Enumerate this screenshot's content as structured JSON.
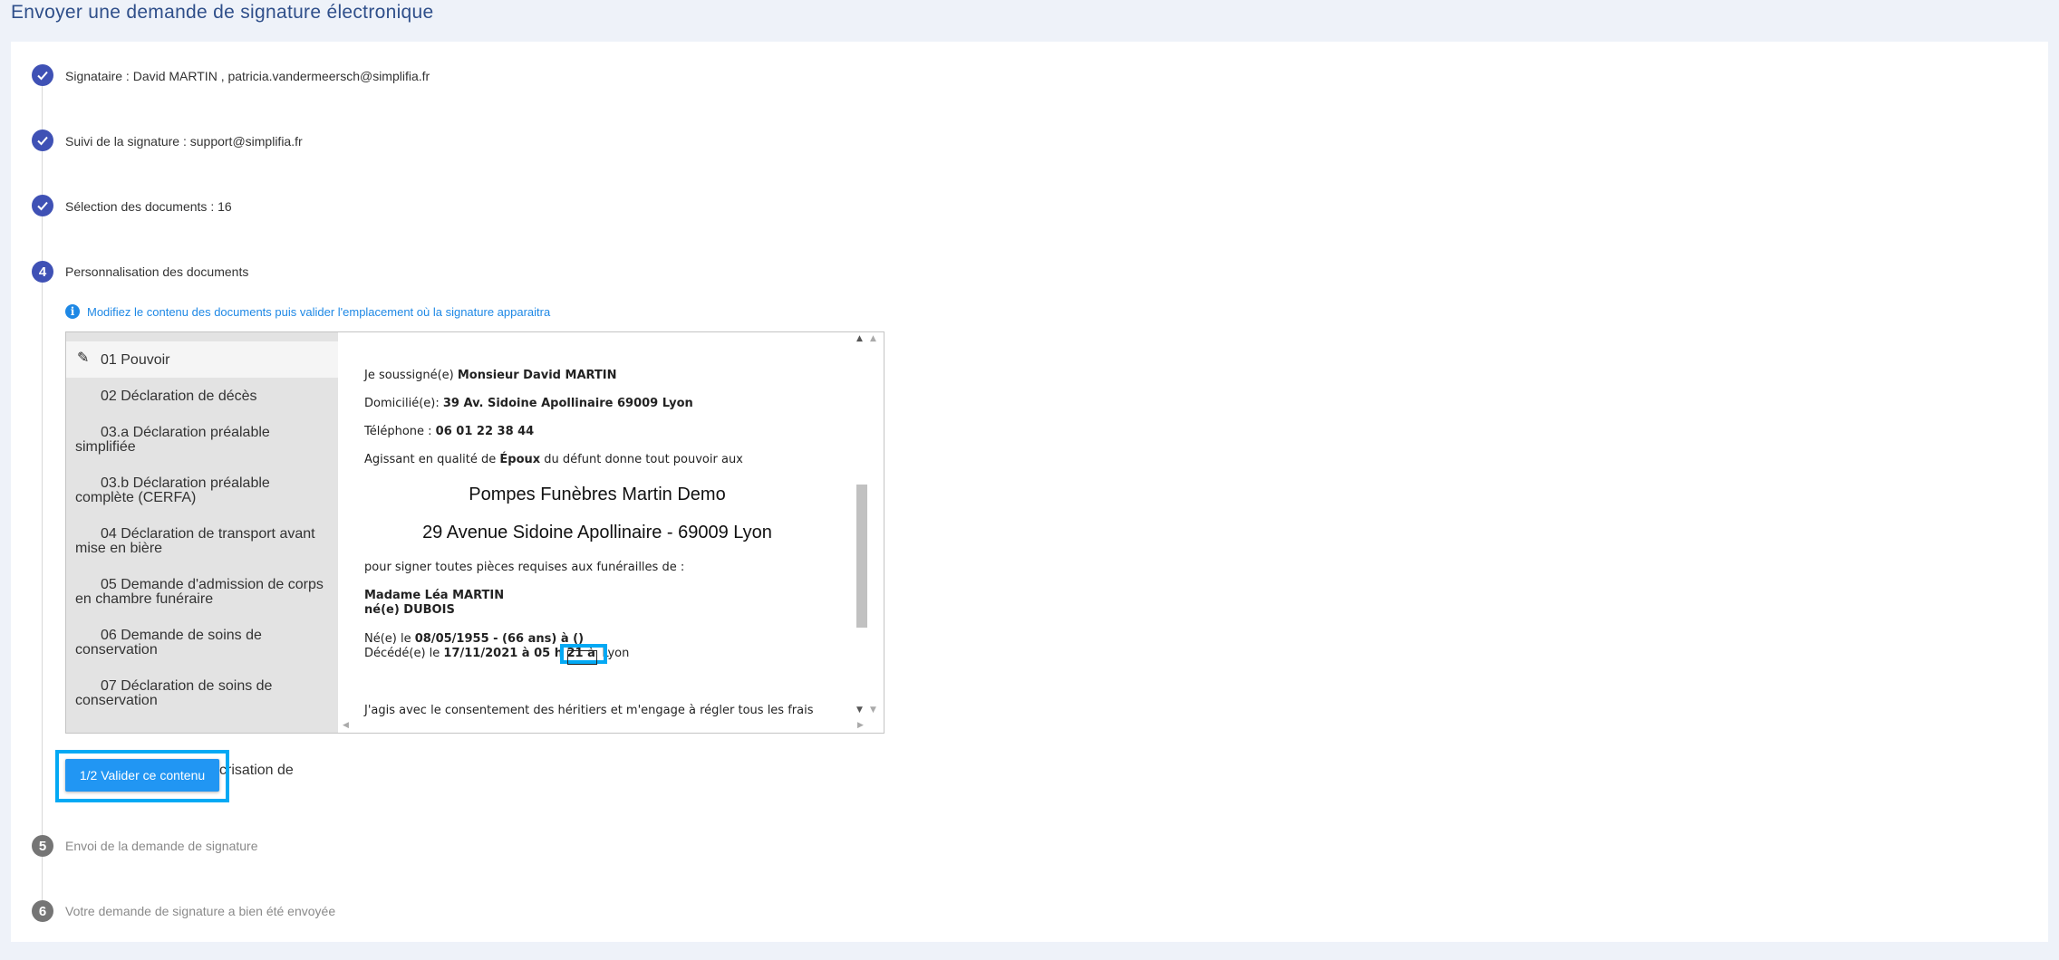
{
  "page": {
    "title": "Envoyer une demande de signature électronique"
  },
  "steps": [
    {
      "number": "",
      "status": "done",
      "label": "Signataire : David MARTIN , patricia.vandermeersch@simplifia.fr"
    },
    {
      "number": "",
      "status": "done",
      "label": "Suivi de la signature : support@simplifia.fr"
    },
    {
      "number": "",
      "status": "done",
      "label": "Sélection des documents : 16"
    },
    {
      "number": "4",
      "status": "active",
      "label": "Personnalisation des documents"
    },
    {
      "number": "5",
      "status": "todo",
      "label": "Envoi de la demande de signature"
    },
    {
      "number": "6",
      "status": "todo",
      "label": "Votre demande de signature a bien été envoyée"
    }
  ],
  "info": {
    "icon": "info-icon",
    "text": "Modifiez le contenu des documents puis valider l'emplacement où la signature apparaitra"
  },
  "documents": [
    {
      "label": "01 Pouvoir",
      "active": true
    },
    {
      "label": "02 Déclaration de décès",
      "active": false
    },
    {
      "label": "03.a Déclaration préalable simplifiée",
      "active": false
    },
    {
      "label": "03.b Déclaration préalable complète (CERFA)",
      "active": false
    },
    {
      "label": "04 Déclaration de transport avant mise en bière",
      "active": false
    },
    {
      "label": "05 Demande d'admission de corps en chambre funéraire",
      "active": false
    },
    {
      "label": "06 Demande de soins de conservation",
      "active": false
    },
    {
      "label": "07 Déclaration de soins de conservation",
      "active": false
    }
  ],
  "document_content": {
    "line1_prefix": "Je soussigné(e) ",
    "line1_value": "Monsieur David MARTIN",
    "line2_prefix": "Domicilié(e): ",
    "line2_value": "39 Av. Sidoine Apollinaire 69009 Lyon",
    "line3_prefix": "Téléphone : ",
    "line3_value": "06 01 22 38 44",
    "line4_prefix": "Agissant en qualité de ",
    "line4_value": "Époux",
    "line4_suffix": " du défunt donne tout pouvoir aux",
    "company_name": "Pompes Funèbres Martin Demo",
    "company_address": "29 Avenue Sidoine Apollinaire - 69009 Lyon",
    "line5": "pour signer toutes pièces requises aux funérailles de :",
    "deceased_name": "Madame Léa MARTIN",
    "deceased_birthname": "né(e) DUBOIS",
    "birth_prefix": "Né(e) le ",
    "birth_value": "08/05/1955 - (66 ans) à ()",
    "death_prefix": "Décédé(e) le ",
    "death_value": "17/11/2021 à 05 h 21 à ",
    "death_place": "Lyon",
    "consent": "J'agis avec le consentement des héritiers et m'engage à régler tous les frais"
  },
  "actions": {
    "validate_label": "1/2 Valider ce contenu",
    "behind_text": "crisation de"
  }
}
